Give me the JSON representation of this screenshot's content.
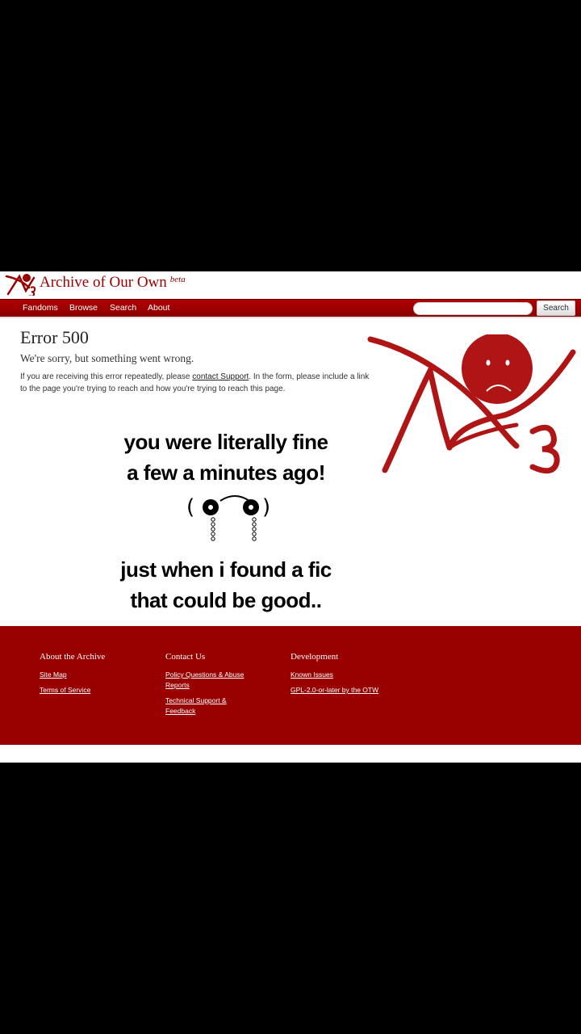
{
  "header": {
    "site_title": "Archive of Our Own",
    "beta_label": "beta"
  },
  "nav": {
    "items": [
      "Fandoms",
      "Browse",
      "Search",
      "About"
    ],
    "search_button": "Search",
    "search_placeholder": ""
  },
  "error": {
    "title": "Error 500",
    "subtitle": "We're sorry, but something went wrong.",
    "body_prefix": "If you are receiving this error repeatedly, please ",
    "link_text": "contact Support",
    "body_suffix": ". In the form, please include a link to the page you're trying to reach and how you're trying to reach this page."
  },
  "overlay": {
    "line1": "you were literally fine",
    "line2": "a few a minutes ago!",
    "line3": "just when i found a fic",
    "line4": "that could be good.."
  },
  "footer": {
    "columns": [
      {
        "heading": "About the Archive",
        "links": [
          "Site Map",
          "Terms of Service"
        ]
      },
      {
        "heading": "Contact Us",
        "links": [
          "Policy Questions & Abuse",
          "Reports",
          "Technical Support &",
          "Feedback"
        ]
      },
      {
        "heading": "Development",
        "links": [
          "Known Issues",
          "GPL-2.0-or-later by the OTW"
        ]
      }
    ]
  },
  "colors": {
    "brand_red": "#990000",
    "background": "#000000"
  }
}
